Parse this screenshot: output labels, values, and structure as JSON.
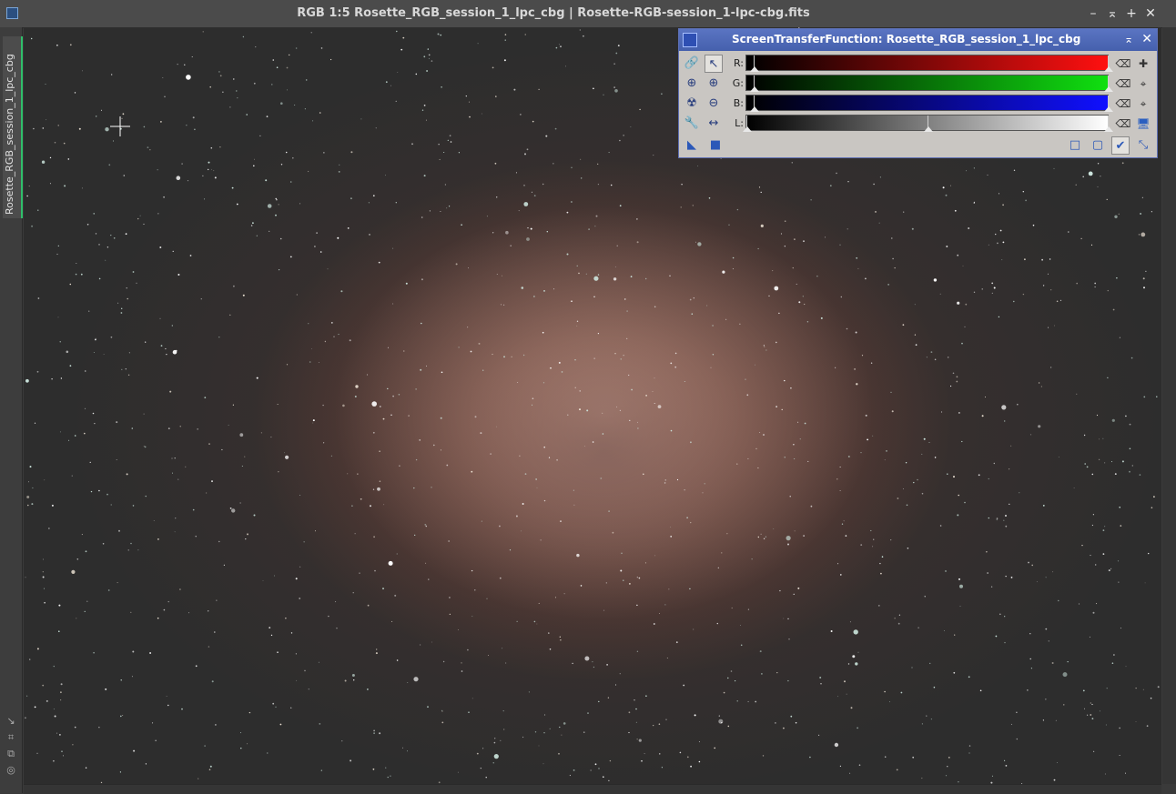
{
  "window": {
    "title": "RGB 1:5 Rosette_RGB_session_1_lpc_cbg | Rosette-RGB-session_1-lpc-cbg.fits",
    "buttons": {
      "minimize": "–",
      "shade": "⌅",
      "maximize": "+",
      "close": "✕"
    }
  },
  "side_tab": {
    "label": "Rosette_RGB_session_1_lpc_cbg"
  },
  "stf": {
    "title": "ScreenTransferFunction: Rosette_RGB_session_1_lpc_cbg",
    "shade_glyph": "⌅",
    "close_glyph": "✕",
    "channels": [
      {
        "label": "R:",
        "from": "#000000",
        "to": "#ff1010",
        "shadows": 0.02,
        "midtones": 0.02,
        "highlights": 1.0
      },
      {
        "label": "G:",
        "from": "#000000",
        "to": "#10e010",
        "shadows": 0.02,
        "midtones": 0.02,
        "highlights": 1.0
      },
      {
        "label": "B:",
        "from": "#000000",
        "to": "#1010ff",
        "shadows": 0.02,
        "midtones": 0.02,
        "highlights": 1.0
      },
      {
        "label": "L:",
        "from": "#000000",
        "to": "#ffffff",
        "shadows": 0.0,
        "midtones": 0.5,
        "highlights": 1.0
      }
    ],
    "icons": {
      "link": "🔗",
      "pointer": "↖",
      "zoom_in_fit": "⊕",
      "zoom_in": "⊕",
      "nuclear": "☢",
      "zoom_out": "⊖",
      "wrench": "🔧",
      "horizontal": "↔",
      "reset": "⌫",
      "auto": "✚",
      "track": "⌖",
      "center": "⌖",
      "display": "🖥",
      "triangle": "◣",
      "square": "■",
      "new_instance": "□",
      "document": "▢",
      "apply": "✔",
      "collapse": "⤡"
    }
  },
  "side_icons": [
    "↘",
    "⌗",
    "⧉",
    "◎"
  ]
}
